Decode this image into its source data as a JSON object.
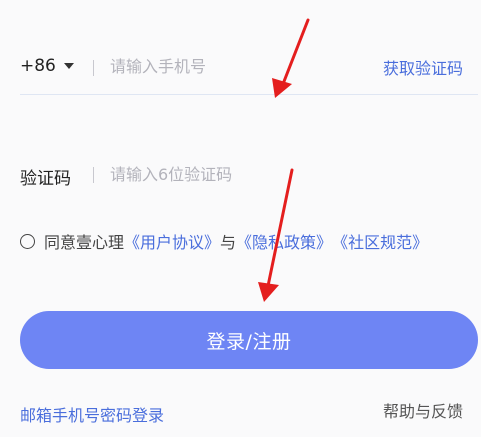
{
  "phone": {
    "country_code": "+86",
    "placeholder": "请输入手机号",
    "value": "",
    "get_code_label": "获取验证码"
  },
  "code": {
    "label": "验证码",
    "placeholder": "请输入6位验证码",
    "value": ""
  },
  "agreement": {
    "checked": false,
    "prefix": "同意壹心理",
    "user_agreement": "《用户协议》",
    "conjunction": "与",
    "privacy_policy": "《隐私政策》",
    "community_rules": "《社区规范》"
  },
  "login_button": {
    "label": "登录/注册"
  },
  "footer": {
    "email_login": "邮箱手机号密码登录",
    "help_feedback": "帮助与反馈"
  },
  "colors": {
    "accent": "#4a6edc",
    "button": "#6e85f4",
    "arrow": "#e41e1e"
  },
  "icons": {
    "dropdown": "caret-down-icon",
    "checkbox": "radio-circle-icon",
    "annotation": "red-arrow-icon"
  }
}
